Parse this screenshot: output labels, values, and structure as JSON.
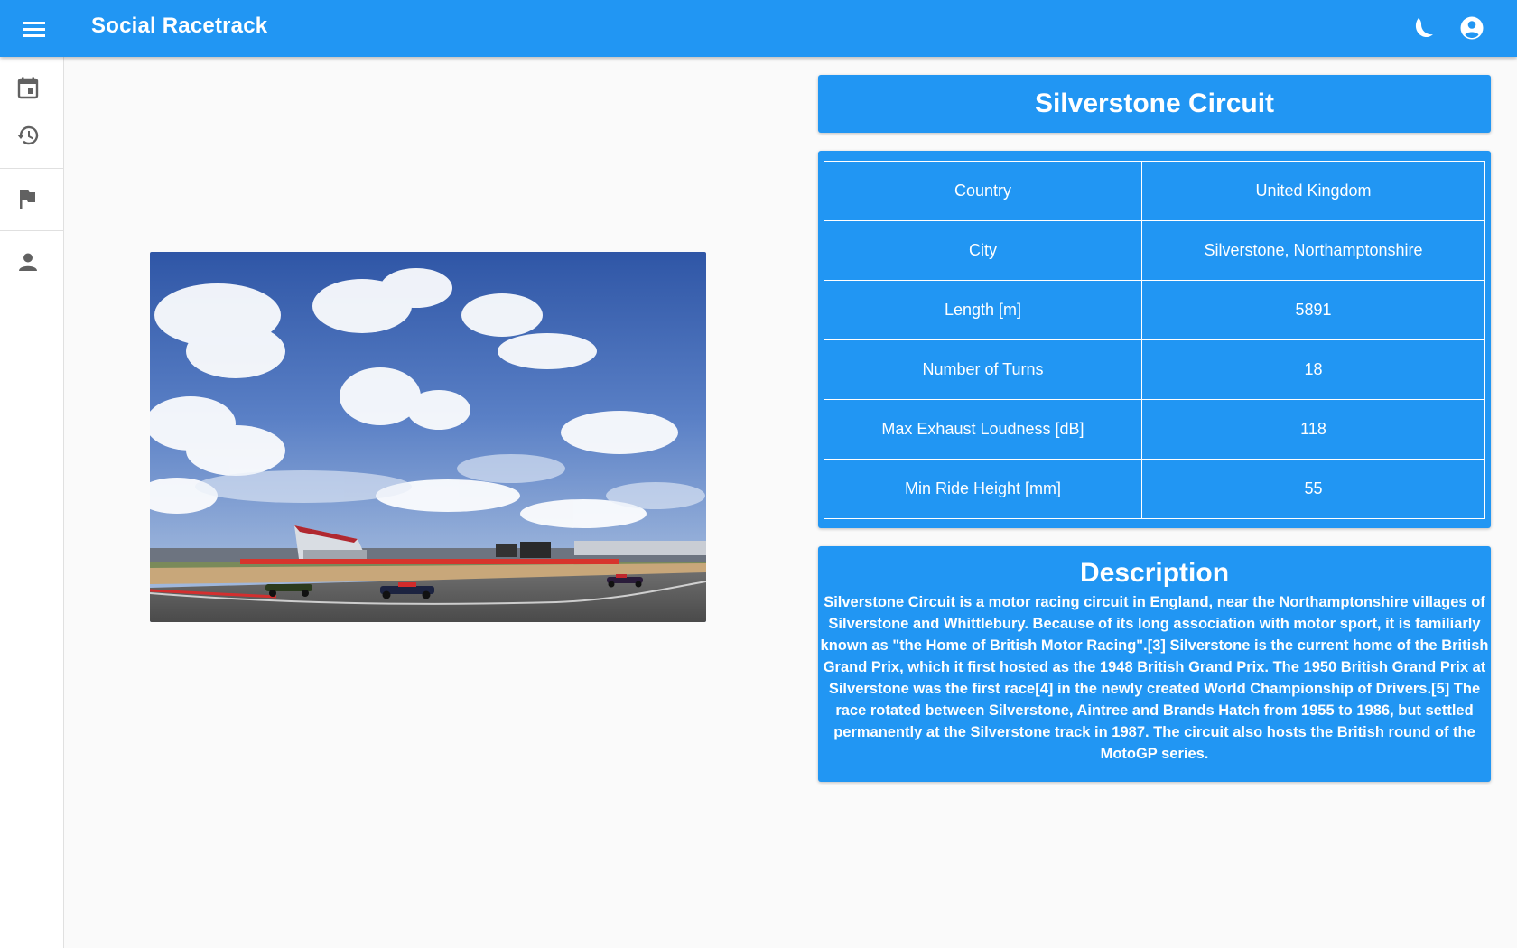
{
  "app": {
    "title": "Social Racetrack"
  },
  "icons": {
    "menu": "menu-icon",
    "theme": "moon-icon",
    "account": "account-circle-icon",
    "sidebar": [
      "calendar-icon",
      "history-icon",
      "flag-icon",
      "person-icon"
    ]
  },
  "colors": {
    "primary": "#2196f3",
    "background": "#fafafa"
  },
  "circuit": {
    "name": "Silverstone Circuit",
    "details": [
      {
        "label": "Country",
        "value": "United Kingdom"
      },
      {
        "label": "City",
        "value": "Silverstone, Northamptonshire"
      },
      {
        "label": "Length [m]",
        "value": "5891"
      },
      {
        "label": "Number of Turns",
        "value": "18"
      },
      {
        "label": "Max Exhaust Loudness [dB]",
        "value": "118"
      },
      {
        "label": "Min Ride Height [mm]",
        "value": "55"
      }
    ],
    "description_title": "Description",
    "description": "Silverstone Circuit is a motor racing circuit in England, near the Northamptonshire villages of Silverstone and Whittlebury. Because of its long association with motor sport, it is familiarly known as \"the Home of British Motor Racing\".[3] Silverstone is the current home of the British Grand Prix, which it first hosted as the 1948 British Grand Prix. The 1950 British Grand Prix at Silverstone was the first race[4] in the newly created World Championship of Drivers.[5] The race rotated between Silverstone, Aintree and Brands Hatch from 1955 to 1986, but settled permanently at the Silverstone track in 1987. The circuit also hosts the British round of the MotoGP series."
  }
}
